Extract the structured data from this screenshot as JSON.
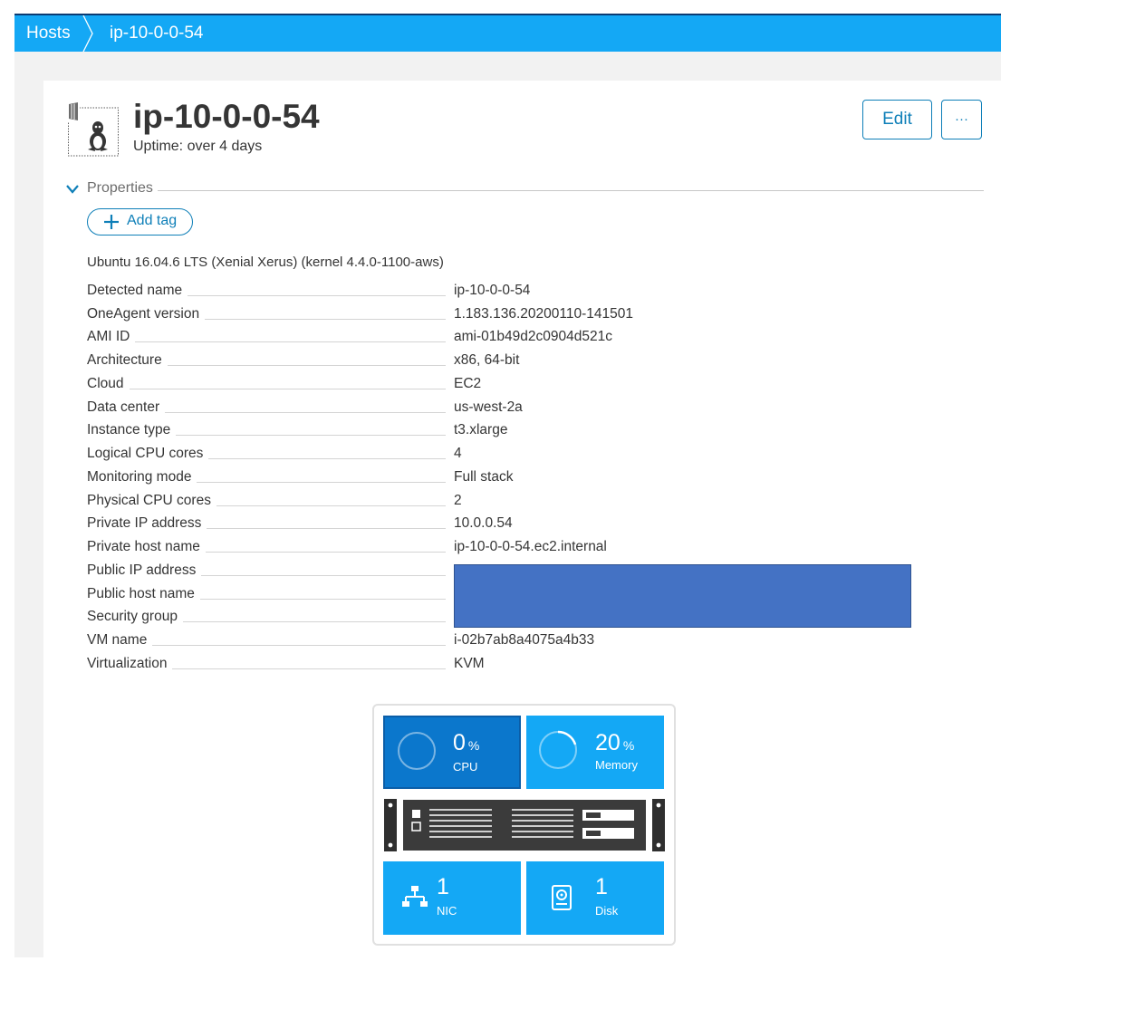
{
  "breadcrumb": {
    "root": "Hosts",
    "current": "ip-10-0-0-54"
  },
  "header": {
    "title": "ip-10-0-0-54",
    "uptime": "Uptime: over 4 days",
    "edit_label": "Edit",
    "more_label": "···",
    "icon": "linux-host-icon"
  },
  "properties": {
    "section_label": "Properties",
    "add_tag_label": "Add tag",
    "os_line": "Ubuntu 16.04.6 LTS (Xenial Xerus) (kernel 4.4.0-1100-aws)",
    "rows": [
      {
        "key": "Detected name",
        "value": "ip-10-0-0-54"
      },
      {
        "key": "OneAgent version",
        "value": "1.183.136.20200110-141501"
      },
      {
        "key": "AMI ID",
        "value": "ami-01b49d2c0904d521c"
      },
      {
        "key": "Architecture",
        "value": "x86, 64-bit"
      },
      {
        "key": "Cloud",
        "value": "EC2"
      },
      {
        "key": "Data center",
        "value": "us-west-2a"
      },
      {
        "key": "Instance type",
        "value": "t3.xlarge"
      },
      {
        "key": "Logical CPU cores",
        "value": "4"
      },
      {
        "key": "Monitoring mode",
        "value": "Full stack"
      },
      {
        "key": "Physical CPU cores",
        "value": "2"
      },
      {
        "key": "Private IP address",
        "value": "10.0.0.54"
      },
      {
        "key": "Private host name",
        "value": "ip-10-0-0-54.ec2.internal"
      },
      {
        "key": "Public IP address",
        "value": ""
      },
      {
        "key": "Public host name",
        "value": ""
      },
      {
        "key": "Security group",
        "value": ""
      },
      {
        "key": "VM name",
        "value": "i-02b7ab8a4075a4b33"
      },
      {
        "key": "Virtualization",
        "value": "KVM"
      }
    ]
  },
  "metrics": {
    "cpu": {
      "value": "0",
      "unit": "%",
      "label": "CPU",
      "fraction": 0.0
    },
    "memory": {
      "value": "20",
      "unit": "%",
      "label": "Memory",
      "fraction": 0.2
    },
    "nic": {
      "value": "1",
      "label": "NIC",
      "icon": "network-icon"
    },
    "disk": {
      "value": "1",
      "label": "Disk",
      "icon": "disk-icon"
    }
  },
  "colors": {
    "accent": "#14a8f5",
    "accent_dark": "#0b77cc",
    "link": "#0e7fb8",
    "redaction": "#4472c4"
  }
}
